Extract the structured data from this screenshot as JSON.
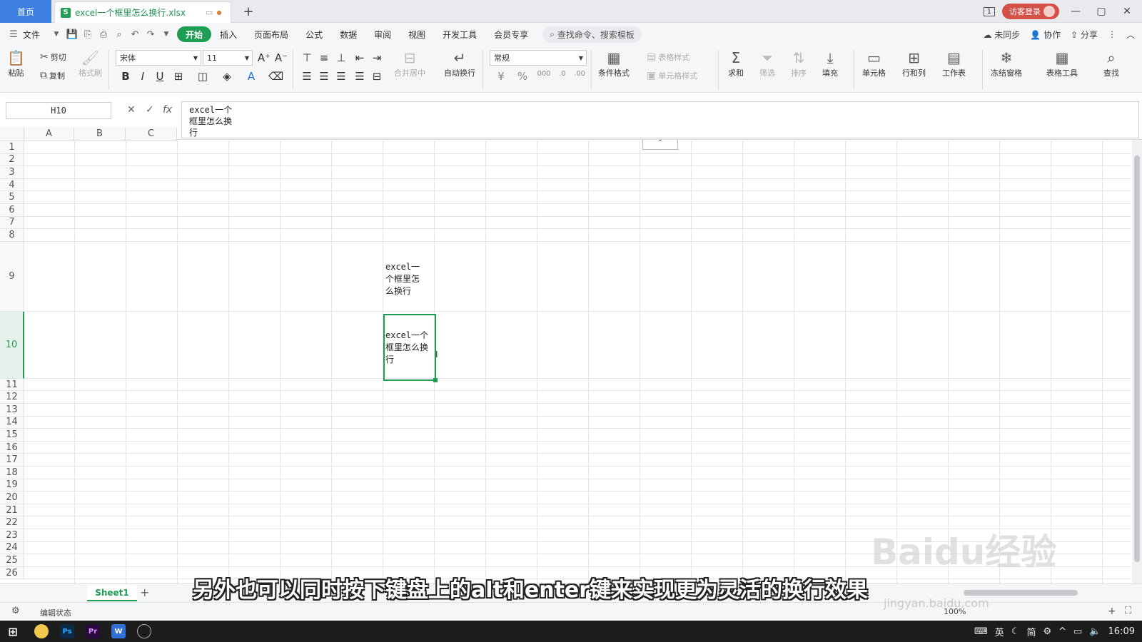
{
  "titlebar": {
    "home_tab": "首页",
    "doc_tab": {
      "badge": "S",
      "title": "excel一个框里怎么换行.xlsx"
    },
    "new_tab": "+",
    "page_indicator": "1",
    "login_button": "访客登录",
    "window_controls": [
      "—",
      "▢",
      "✕"
    ]
  },
  "menubar": {
    "file": "文件",
    "tabs": [
      "开始",
      "插入",
      "页面布局",
      "公式",
      "数据",
      "审阅",
      "视图",
      "开发工具",
      "会员专享"
    ],
    "active_tab": "开始",
    "search": "查找命令、搜索模板",
    "right": [
      "未同步",
      "协作",
      "分享"
    ]
  },
  "toolbar": {
    "paste": "粘贴",
    "cut": "剪切",
    "copy": "复制",
    "format_painter": "格式刷",
    "font_name": "宋体",
    "font_size": "11",
    "merge_center": "合并居中",
    "auto_wrap": "自动换行",
    "number_format": "常规",
    "conditional_format": "条件格式",
    "table_style": "表格样式",
    "cell_style": "单元格样式",
    "sum": "求和",
    "filter": "筛选",
    "sort": "排序",
    "fill": "填充",
    "cell": "单元格",
    "row_col": "行和列",
    "worksheet": "工作表",
    "freeze": "冻结窗格",
    "table_tools": "表格工具",
    "find": "查找"
  },
  "formula_bar": {
    "cell_ref": "H10",
    "fx": "fx",
    "content": "excel一个\n框里怎么换\n行"
  },
  "grid": {
    "columns": [
      "A",
      "B",
      "C"
    ],
    "rows": [
      "1",
      "2",
      "3",
      "4",
      "5",
      "6",
      "7",
      "8",
      "9",
      "10",
      "11",
      "12",
      "13",
      "14",
      "15",
      "16",
      "17",
      "18",
      "19",
      "20",
      "21",
      "22",
      "23",
      "24",
      "25",
      "26"
    ],
    "selected_row": "10",
    "cell_h9": "excel一\n个框里怎\n么换行",
    "cell_h10": "excel一个\n框里怎么换\n行"
  },
  "sheets": {
    "tabs": [
      "Sheet1"
    ],
    "add": "+"
  },
  "status": {
    "mode": "编辑状态",
    "zoom": "100%"
  },
  "subtitle": "另外也可以同时按下键盘上的alt和enter键来实现更为灵活的换行效果",
  "watermark": {
    "logo": "Baidu经验",
    "url": "jingyan.baidu.com"
  },
  "taskbar": {
    "tray": [
      "英",
      "简"
    ],
    "time": "16:09"
  },
  "colors": {
    "accent": "#1e9e54",
    "home_tab": "#3d7fe0",
    "login": "#d6504a"
  }
}
